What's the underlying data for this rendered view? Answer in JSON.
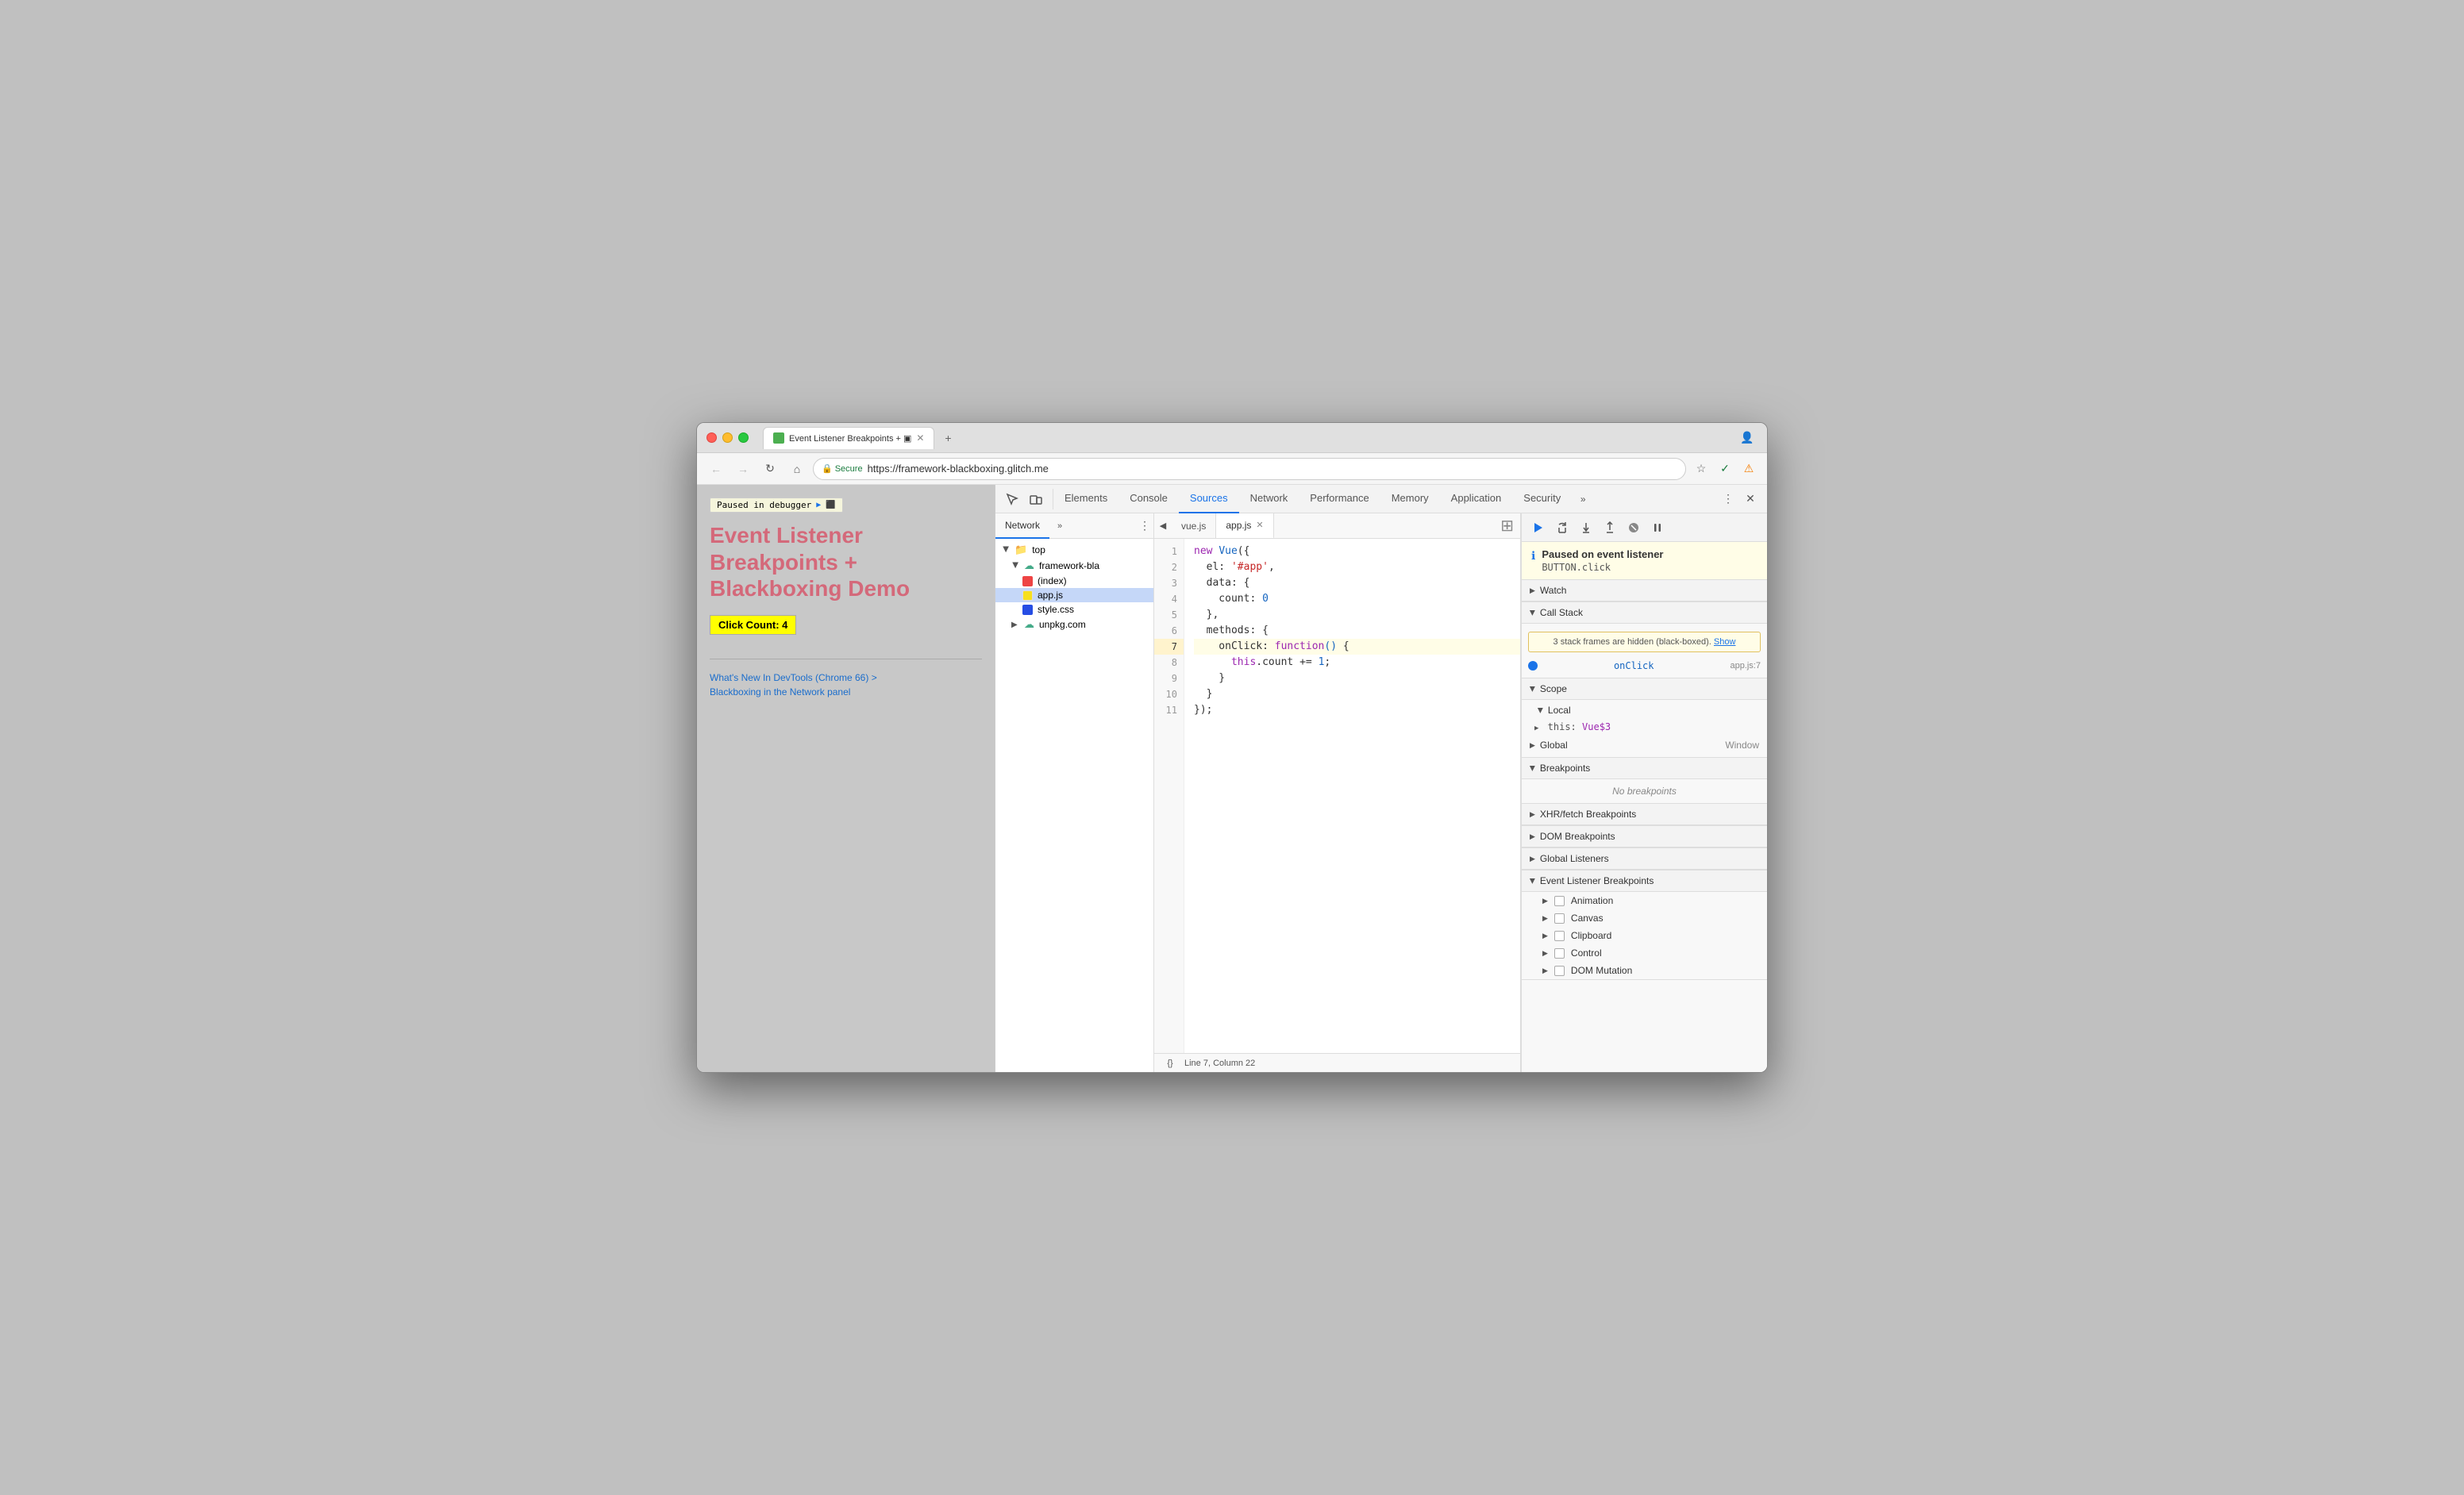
{
  "titleBar": {
    "tabTitle": "Event Listener Breakpoints + ▣",
    "tabExtra": "▣",
    "windowIcon": "👤"
  },
  "addressBar": {
    "url": "https://framework-blackboxing.glitch.me",
    "secure": "Secure"
  },
  "page": {
    "debuggerBanner": "Paused in debugger",
    "title": "Event Listener Breakpoints + Blackboxing Demo",
    "clickCount": "Click Count: 4",
    "link1": "What's New In DevTools (Chrome 66) >",
    "link2": "Blackboxing in the Network panel"
  },
  "devtools": {
    "tabs": [
      "Elements",
      "Console",
      "Sources",
      "Network",
      "Performance",
      "Memory",
      "Application",
      "Security"
    ],
    "activeTab": "Sources"
  },
  "sources": {
    "subTabs": [
      "Network"
    ],
    "fileTree": {
      "top": "top",
      "framework": "framework-bla",
      "files": [
        "(index)",
        "app.js",
        "style.css"
      ],
      "unpkg": "unpkg.com"
    },
    "openFiles": [
      "vue.js",
      "app.js"
    ],
    "activeFile": "app.js"
  },
  "editor": {
    "lines": [
      {
        "num": 1,
        "code": "new Vue({"
      },
      {
        "num": 2,
        "code": "  el: '#app',"
      },
      {
        "num": 3,
        "code": "  data: {"
      },
      {
        "num": 4,
        "code": "    count: 0"
      },
      {
        "num": 5,
        "code": "  },"
      },
      {
        "num": 6,
        "code": "  methods: {"
      },
      {
        "num": 7,
        "code": "    onClick: function() {",
        "highlight": true
      },
      {
        "num": 8,
        "code": "      this.count += 1;"
      },
      {
        "num": 9,
        "code": "    }"
      },
      {
        "num": 10,
        "code": "  }"
      },
      {
        "num": 11,
        "code": "});"
      }
    ],
    "statusBar": "Line 7, Column 22"
  },
  "debugPanel": {
    "pausedTitle": "Paused on event listener",
    "pausedDetail": "BUTTON.click",
    "sections": {
      "watch": "Watch",
      "callStack": "Call Stack",
      "scope": "Scope",
      "local": "Local",
      "global": "Global",
      "breakpoints": "Breakpoints",
      "xhrBreakpoints": "XHR/fetch Breakpoints",
      "domBreakpoints": "DOM Breakpoints",
      "globalListeners": "Global Listeners",
      "eventListenerBreakpoints": "Event Listener Breakpoints"
    },
    "blackboxNotice": "3 stack frames are hidden (black-boxed).",
    "showLink": "Show",
    "onClickFn": "onClick",
    "onClickLoc": "app.js:7",
    "thisVal": "Vue$3",
    "globalVal": "Window",
    "noBreakpoints": "No breakpoints",
    "eventCategories": [
      "Animation",
      "Canvas",
      "Clipboard",
      "Control",
      "DOM Mutation"
    ]
  }
}
